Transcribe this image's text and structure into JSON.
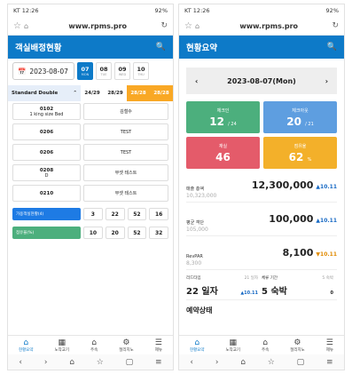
{
  "status_bar": {
    "time": "KT 12:26",
    "battery": "92%"
  },
  "browser": {
    "url": "www.rpms.pro"
  },
  "screen1": {
    "title": "객실배정현황",
    "date": "2023-08-07",
    "days": [
      {
        "num": "07",
        "label": "MON"
      },
      {
        "num": "08",
        "label": "TUE"
      },
      {
        "num": "09",
        "label": "WED"
      },
      {
        "num": "10",
        "label": "THU"
      }
    ],
    "room_type": {
      "name": "Standard Double",
      "counts": [
        "24/29",
        "28/29",
        "28/28",
        "28/28"
      ]
    },
    "rooms": [
      {
        "number": "0102",
        "sub": "1 king size Bed",
        "guest": "김철수"
      },
      {
        "number": "0206",
        "sub": "",
        "guest": "TEST"
      },
      {
        "number": "0206",
        "sub": "",
        "guest": "TEST"
      },
      {
        "number": "0208",
        "sub": "D",
        "guest": "부셋 테스트"
      },
      {
        "number": "0210",
        "sub": "",
        "guest": "부셋 테스트"
      }
    ],
    "summary": [
      {
        "label": "가용객실현황(4)",
        "values": [
          "3",
          "22",
          "52",
          "16"
        ]
      },
      {
        "label": "점유율(%)",
        "values": [
          "10",
          "20",
          "52",
          "32"
        ]
      }
    ]
  },
  "screen2": {
    "title": "현황요약",
    "date": "2023-08-07(Mon)",
    "tiles": [
      {
        "label": "체크인",
        "value": "12",
        "sub": "/ 24"
      },
      {
        "label": "체크아웃",
        "value": "20",
        "sub": "/ 21"
      },
      {
        "label": "재실",
        "value": "46",
        "sub": ""
      },
      {
        "label": "점유율",
        "value": "62",
        "sub": "%"
      }
    ],
    "metrics": [
      {
        "label": "매출 총액",
        "value": "12,300,000",
        "prev": "10,323,000",
        "change": "▲10.11"
      },
      {
        "label": "평균 객단",
        "value": "100,000",
        "prev": "105,000",
        "change": "▲10.11"
      },
      {
        "label": "RevPAR",
        "value": "8,100",
        "prev": "8,300",
        "change": "▼10.11"
      }
    ],
    "lead": {
      "label": "리드타임",
      "extra": "21 일자",
      "value": "22 일자",
      "change": "▲10.11"
    },
    "stay": {
      "label": "체류 기간",
      "extra": "5 숙박",
      "value": "5 숙박",
      "change": "0"
    },
    "section_title": "예약상태"
  },
  "bottom_nav": [
    "현황요약",
    "노작교기",
    "주속",
    "절리지노",
    "제뉴"
  ],
  "colors": {
    "primary": "#0d7ac8",
    "checkin": "#4caf7d",
    "checkout": "#5e9ee0",
    "stay": "#e45b6a",
    "occupancy": "#f3b02a",
    "orange": "#f9a825"
  }
}
